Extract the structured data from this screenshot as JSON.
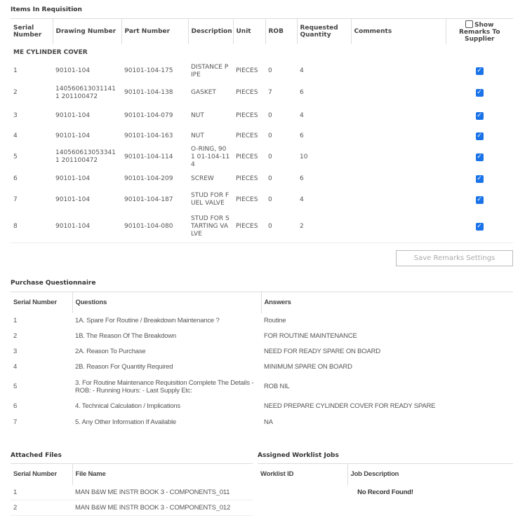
{
  "items": {
    "title": "Items In Requisition",
    "headers": [
      "Serial Number",
      "Drawing Number",
      "Part Number",
      "Description",
      "Unit",
      "ROB",
      "Requested Quantity",
      "Comments",
      "Show Remarks To Supplier"
    ],
    "show_remarks_all_checked": false,
    "group": "ME CYLINDER COVER",
    "rows": [
      {
        "serial": "1",
        "drawing": "90101-104",
        "part": "90101-104-175",
        "description": "DISTANCE P IPE",
        "unit": "PIECES",
        "rob": "0",
        "qty": "4",
        "comments": "",
        "show": true
      },
      {
        "serial": "2",
        "drawing": "1405606130311411 201100472",
        "part": "90101-104-138",
        "description": "GASKET",
        "unit": "PIECES",
        "rob": "7",
        "qty": "6",
        "comments": "",
        "show": true
      },
      {
        "serial": "3",
        "drawing": "90101-104",
        "part": "90101-104-079",
        "description": "NUT",
        "unit": "PIECES",
        "rob": "0",
        "qty": "4",
        "comments": "",
        "show": true
      },
      {
        "serial": "4",
        "drawing": "90101-104",
        "part": "90101-104-163",
        "description": "NUT",
        "unit": "PIECES",
        "rob": "0",
        "qty": "6",
        "comments": "",
        "show": true
      },
      {
        "serial": "5",
        "drawing": "1405606130533411 201100472",
        "part": "90101-104-114",
        "description": "O-RING, 901 01-104-114",
        "unit": "PIECES",
        "rob": "0",
        "qty": "10",
        "comments": "",
        "show": true
      },
      {
        "serial": "6",
        "drawing": "90101-104",
        "part": "90101-104-209",
        "description": "SCREW",
        "unit": "PIECES",
        "rob": "0",
        "qty": "6",
        "comments": "",
        "show": true
      },
      {
        "serial": "7",
        "drawing": "90101-104",
        "part": "90101-104-187",
        "description": "STUD FOR F UEL VALVE",
        "unit": "PIECES",
        "rob": "0",
        "qty": "4",
        "comments": "",
        "show": true
      },
      {
        "serial": "8",
        "drawing": "90101-104",
        "part": "90101-104-080",
        "description": "STUD FOR S TARTING VA LVE",
        "unit": "PIECES",
        "rob": "0",
        "qty": "2",
        "comments": "",
        "show": true
      }
    ],
    "save_button": "Save Remarks Settings"
  },
  "questionnaire": {
    "title": "Purchase Questionnaire",
    "headers": [
      "Serial Number",
      "Questions",
      "Answers"
    ],
    "rows": [
      {
        "serial": "1",
        "question": "1A. Spare For Routine / Breakdown Maintenance ?",
        "answer": "Routine"
      },
      {
        "serial": "2",
        "question": "1B. The Reason Of The Breakdown",
        "answer": "FOR ROUTINE MAINTENANCE"
      },
      {
        "serial": "3",
        "question": "2A. Reason To Purchase",
        "answer": "NEED FOR READY SPARE ON BOARD"
      },
      {
        "serial": "4",
        "question": "2B. Reason For Quantity Required",
        "answer": "MINIMUM SPARE ON BOARD"
      },
      {
        "serial": "5",
        "question": "3. For Routine Maintenance Requisition Complete The Details - ROB: - Running Hours: - Last Supply Etc:",
        "answer": "ROB NIL"
      },
      {
        "serial": "6",
        "question": "4. Technical Calculation / Implications",
        "answer": "NEED PREPARE CYLINDER COVER FOR READY SPARE"
      },
      {
        "serial": "7",
        "question": "5. Any Other Information If Available",
        "answer": "NA"
      }
    ]
  },
  "attached": {
    "title": "Attached Files",
    "headers": [
      "Serial Number",
      "File Name"
    ],
    "rows": [
      {
        "serial": "1",
        "file": "MAN B&W ME INSTR BOOK 3 - COMPONENTS_011"
      },
      {
        "serial": "2",
        "file": "MAN B&W ME INSTR BOOK 3 - COMPONENTS_012"
      }
    ]
  },
  "worklist": {
    "title": "Assigned Worklist Jobs",
    "headers": [
      "Worklist ID",
      "Job Description"
    ],
    "empty": "No Record Found!"
  },
  "colors": {
    "checkbox": "#1a73e8",
    "border": "#dddddd"
  }
}
